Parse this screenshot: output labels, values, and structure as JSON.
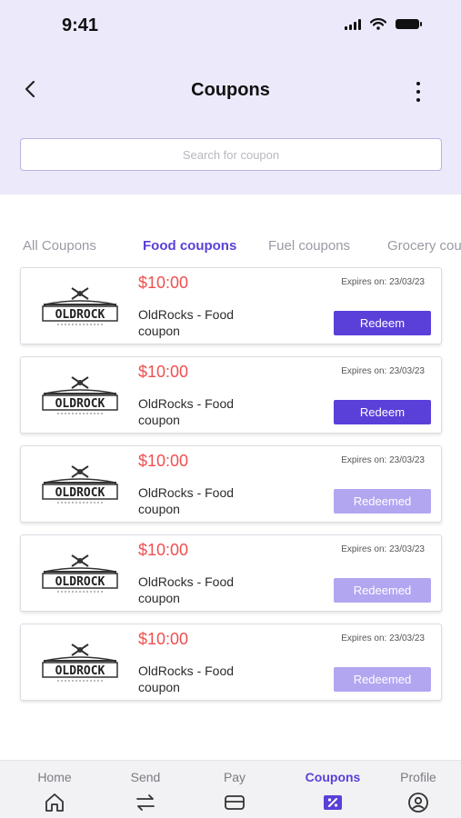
{
  "status_bar": {
    "time": "9:41"
  },
  "header": {
    "title": "Coupons"
  },
  "search": {
    "placeholder": "Search for coupon",
    "value": ""
  },
  "tabs": [
    {
      "label": "All Coupons",
      "active": false
    },
    {
      "label": "Food coupons",
      "active": true
    },
    {
      "label": "Fuel coupons",
      "active": false
    },
    {
      "label": "Grocery coupons",
      "active": false
    }
  ],
  "coupons": [
    {
      "price": "$10:00",
      "expiry": "Expires on: 23/03/23",
      "name": "OldRocks - Food coupon",
      "button": "Redeem",
      "redeemed": false,
      "logo_text": "OLDROCK"
    },
    {
      "price": "$10:00",
      "expiry": "Expires on: 23/03/23",
      "name": "OldRocks - Food coupon",
      "button": "Redeem",
      "redeemed": false,
      "logo_text": "OLDROCK"
    },
    {
      "price": "$10:00",
      "expiry": "Expires on: 23/03/23",
      "name": "OldRocks - Food coupon",
      "button": "Redeemed",
      "redeemed": true,
      "logo_text": "OLDROCK"
    },
    {
      "price": "$10:00",
      "expiry": "Expires on: 23/03/23",
      "name": "OldRocks - Food coupon",
      "button": "Redeemed",
      "redeemed": true,
      "logo_text": "OLDROCK"
    },
    {
      "price": "$10:00",
      "expiry": "Expires on: 23/03/23",
      "name": "OldRocks - Food coupon",
      "button": "Redeemed",
      "redeemed": true,
      "logo_text": "OLDROCK"
    }
  ],
  "bottom_nav": [
    {
      "label": "Home",
      "icon": "home-icon",
      "active": false
    },
    {
      "label": "Send",
      "icon": "transfer-icon",
      "active": false
    },
    {
      "label": "Pay",
      "icon": "card-icon",
      "active": false
    },
    {
      "label": "Coupons",
      "icon": "coupon-icon",
      "active": true
    },
    {
      "label": "Profile",
      "icon": "profile-icon",
      "active": false
    }
  ],
  "colors": {
    "accent": "#5b3fd9",
    "accent_light": "#b3a6f1",
    "header_bg": "#ece9fb",
    "price": "#ef4f4f"
  }
}
